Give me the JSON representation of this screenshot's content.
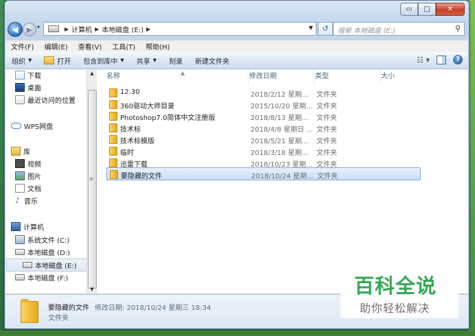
{
  "window": {
    "controls": {
      "minimize": "▭",
      "maximize": "□",
      "close": "✕"
    }
  },
  "address_bar": {
    "crumbs": [
      "计算机",
      "本地磁盘 (E:)"
    ],
    "search_placeholder": "搜索 本地磁盘 (E:)"
  },
  "menu": [
    "文件(F)",
    "编辑(E)",
    "查看(V)",
    "工具(T)",
    "帮助(H)"
  ],
  "toolbar": {
    "organize": "组织",
    "open": "打开",
    "include_in_library": "包含到库中",
    "share": "共享",
    "burn": "刻录",
    "new_folder": "新建文件夹"
  },
  "nav_pane": {
    "favorites": [
      "下载",
      "桌面",
      "最近访问的位置"
    ],
    "wps_cloud": "WPS网盘",
    "libraries_title": "库",
    "libraries": [
      "视频",
      "图片",
      "文档",
      "音乐"
    ],
    "computer_title": "计算机",
    "drives": [
      "系统文件 (C:)",
      "本地磁盘 (D:)",
      "本地磁盘 (E:)",
      "本地磁盘 (F:)"
    ]
  },
  "file_list": {
    "columns": [
      "名称",
      "修改日期",
      "类型",
      "大小"
    ],
    "rows": [
      {
        "name": "12.30",
        "date": "2018/2/12 星期...",
        "type": "文件夹"
      },
      {
        "name": "360驱动大师目录",
        "date": "2015/10/20 星期...",
        "type": "文件夹"
      },
      {
        "name": "Photoshop7.0简体中文注册版",
        "date": "2018/8/13 星期...",
        "type": "文件夹"
      },
      {
        "name": "技术标",
        "date": "2018/4/8 星期日 ...",
        "type": "文件夹"
      },
      {
        "name": "技术标模版",
        "date": "2018/5/21 星期...",
        "type": "文件夹"
      },
      {
        "name": "临时",
        "date": "2018/3/18 星期...",
        "type": "文件夹"
      },
      {
        "name": "迅雷下载",
        "date": "2018/10/23 星期...",
        "type": "文件夹"
      },
      {
        "name": "要隐藏的文件",
        "date": "2018/10/24 星期...",
        "type": "文件夹"
      }
    ],
    "selected_index": 7
  },
  "details_pane": {
    "name": "要隐藏的文件",
    "modified": "修改日期: 2018/10/24 星期三 18:34",
    "type": "文件夹"
  },
  "watermark": {
    "title": "百科全说",
    "subtitle": "助你轻松解决"
  },
  "colors": {
    "selection": "#cce4f7",
    "toolbar": "#dde8f5",
    "watermark_green": "#34a853"
  }
}
